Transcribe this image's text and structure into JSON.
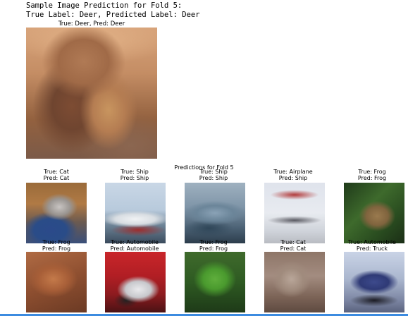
{
  "output": {
    "line1": "Sample Image Prediction for Fold 5:",
    "line2": "True Label: Deer, Predicted Label: Deer"
  },
  "main_image": {
    "title": "True: Deer, Pred: Deer"
  },
  "grid": {
    "suptitle": "Predictions for Fold 5",
    "tiles": [
      {
        "true": "True: Cat",
        "pred": "Pred: Cat"
      },
      {
        "true": "True: Ship",
        "pred": "Pred: Ship"
      },
      {
        "true": "True: Ship",
        "pred": "Pred: Ship"
      },
      {
        "true": "True: Airplane",
        "pred": "Pred: Ship"
      },
      {
        "true": "True: Frog",
        "pred": "Pred: Frog"
      },
      {
        "true": "True: Frog",
        "pred": "Pred: Frog"
      },
      {
        "true": "True: Automobile",
        "pred": "Pred: Automobile"
      },
      {
        "true": "True: Frog",
        "pred": "Pred: Frog"
      },
      {
        "true": "True: Cat",
        "pred": "Pred: Cat"
      },
      {
        "true": "True: Automobile",
        "pred": "Pred: Truck"
      }
    ]
  }
}
